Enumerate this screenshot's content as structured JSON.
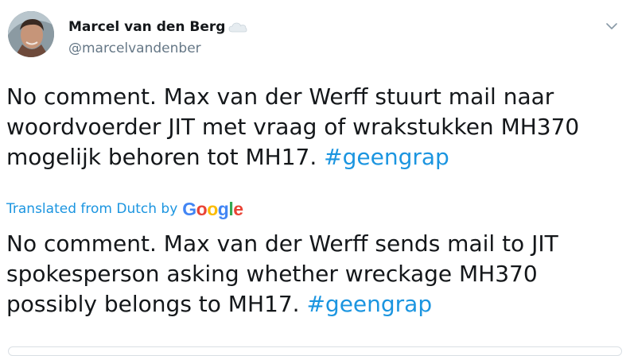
{
  "author": {
    "name": "Marcel van den Berg",
    "handle": "@marcelvandenber",
    "badge_icon": "cloud-icon"
  },
  "tweet": {
    "text": "No comment. Max van der Werff stuurt mail naar woordvoerder JIT met vraag of wrakstukken MH370 mogelijk behoren tot MH17. ",
    "hashtag": "#geengrap"
  },
  "translation": {
    "label": "Translated from Dutch by",
    "provider": [
      "G",
      "o",
      "o",
      "g",
      "l",
      "e"
    ],
    "text": "No comment. Max van der Werff sends mail to JIT spokesperson asking whether wreckage MH370 possibly belongs to MH17. ",
    "hashtag": "#geengrap"
  },
  "colors": {
    "link": "#1b95e0",
    "google": [
      "#4285F4",
      "#EA4335",
      "#FBBC05",
      "#4285F4",
      "#34A853",
      "#EA4335"
    ]
  }
}
